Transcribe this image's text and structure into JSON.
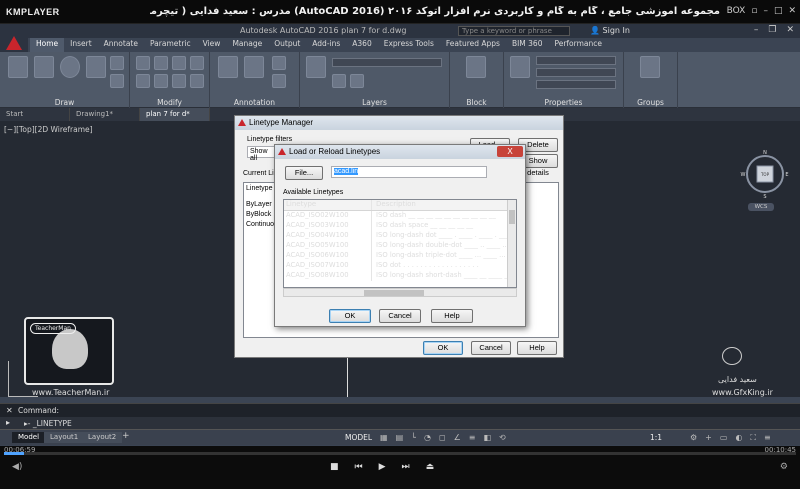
{
  "player": {
    "logo": "KMPLAYER",
    "title": "مجموعه آموزشی جامع ، گام به گام و کاربردی نرم افزار  اتوکد ۲۰۱۶  (AutoCAD 2016)   مدرس : سعید فدایی ( تیچرمن ) گروه آموزشی پادشاه گرافیست ها",
    "box_label": "BOX",
    "time_current": "00:06:59",
    "time_total": "00:10:45"
  },
  "autocad": {
    "window_title": "Autodesk AutoCAD 2016   plan 7 for d.dwg",
    "search_placeholder": "Type a keyword or phrase",
    "sign_in": "Sign In",
    "ribbon_tabs": [
      "Home",
      "Insert",
      "Annotate",
      "Parametric",
      "View",
      "Manage",
      "Output",
      "Add-ins",
      "A360",
      "Express Tools",
      "Featured Apps",
      "BIM 360",
      "Performance"
    ],
    "active_tab": "Home",
    "panels": [
      "Draw",
      "Modify",
      "Annotation",
      "Layers",
      "Block",
      "Properties",
      "Groups"
    ],
    "file_tabs": [
      "Start",
      "Drawing1*",
      "plan 7 for d*"
    ],
    "active_file_tab": "plan 7 for d*",
    "viewport_control": "[−][Top][2D Wireframe]",
    "viewcube": {
      "top": "TOP",
      "north": "N",
      "west": "W",
      "east": "E",
      "south": "S",
      "wcs": "WCS"
    },
    "command_label": "Command:",
    "command_input": "_LINETYPE",
    "layout_tabs": [
      "Model",
      "Layout1",
      "Layout2"
    ],
    "active_layout_tab": "Model",
    "status_model": "MODEL",
    "status_scale": "1:1"
  },
  "linetype_manager": {
    "title": "Linetype Manager",
    "filters_label": "Linetype filters",
    "filter_value": "Show all",
    "load_button": "Load...",
    "delete_button": "Delete",
    "details_button": "Show details",
    "current_label": "Current Linetype:",
    "list_header": "Linetype",
    "list_items": [
      "ByLayer",
      "ByBlock",
      "Continuous"
    ],
    "ok": "OK",
    "cancel": "Cancel",
    "help": "Help"
  },
  "load_reload": {
    "title": "Load or Reload Linetypes",
    "close": "X",
    "file_button": "File...",
    "file_value": "acad.lin",
    "available_label": "Available Linetypes",
    "col_linetype": "Linetype",
    "col_description": "Description",
    "rows": [
      {
        "name": "ACAD_ISO02W100",
        "desc": "ISO dash __ __ __ __ __ __ __ __ __ __"
      },
      {
        "name": "ACAD_ISO03W100",
        "desc": "ISO dash space __    __    __    __    __"
      },
      {
        "name": "ACAD_ISO04W100",
        "desc": "ISO long-dash dot ____ . ____ . ____ . ____"
      },
      {
        "name": "ACAD_ISO05W100",
        "desc": "ISO long-dash double-dot ____ .. ____ .. ____"
      },
      {
        "name": "ACAD_ISO06W100",
        "desc": "ISO long-dash triple-dot ____ ... ____ ..."
      },
      {
        "name": "ACAD_ISO07W100",
        "desc": "ISO dot . . . . . . . . . . . . . . . . . ."
      },
      {
        "name": "ACAD_ISO08W100",
        "desc": "ISO long-dash short-dash ____ __ ____ __"
      }
    ],
    "ok": "OK",
    "cancel": "Cancel",
    "help": "Help"
  },
  "watermark": {
    "teacher_site": "www.TeacherMan.ir",
    "teacher_badge": "TeacherMan",
    "gfx_name": "سعید فدایی",
    "gfx_site": "www.GfxKing.ir"
  },
  "colors": {
    "autocad_logo": "#c9252c",
    "seek": "#4fa3ff",
    "ribbon": "#4f5968"
  }
}
